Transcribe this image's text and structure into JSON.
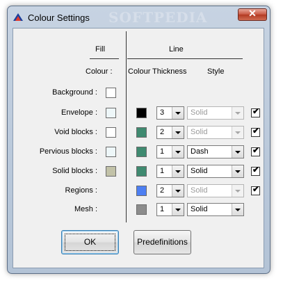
{
  "window": {
    "title": "Colour Settings",
    "watermark": "SOFTPEDIA",
    "close_glyph": "✕"
  },
  "headers": {
    "fill": "Fill",
    "line": "Line",
    "fill_colour": "Colour :",
    "line_colour": "Colour",
    "thickness": "Thickness",
    "style": "Style"
  },
  "rows": [
    {
      "label": "Background :",
      "fill": "#ffffff"
    },
    {
      "label": "Envelope :",
      "fill": "#eef7f9",
      "line_colour": "#000000",
      "thickness": "3",
      "style": "Solid",
      "style_enabled": false,
      "checked": true
    },
    {
      "label": "Void blocks :",
      "fill": "#ffffff",
      "line_colour": "#3f8a70",
      "thickness": "2",
      "style": "Solid",
      "style_enabled": false,
      "checked": true
    },
    {
      "label": "Pervious blocks :",
      "fill": "#eef7f9",
      "line_colour": "#3f8a70",
      "thickness": "1",
      "style": "Dash",
      "style_enabled": true,
      "checked": true
    },
    {
      "label": "Solid blocks :",
      "fill": "#c2c2a8",
      "line_colour": "#3f8a70",
      "thickness": "1",
      "style": "Solid",
      "style_enabled": true,
      "checked": true
    },
    {
      "label": "Regions :",
      "line_colour": "#4d7ff2",
      "thickness": "2",
      "style": "Solid",
      "style_enabled": false,
      "checked": true
    },
    {
      "label": "Mesh :",
      "line_colour": "#8c8c8c",
      "thickness": "1",
      "style": "Solid",
      "style_enabled": true
    }
  ],
  "buttons": {
    "ok": "OK",
    "predefinitions": "Predefinitions"
  },
  "icons": {
    "app": "app-logo-icon",
    "close": "close-icon",
    "checkbox": "checkmark-icon"
  }
}
